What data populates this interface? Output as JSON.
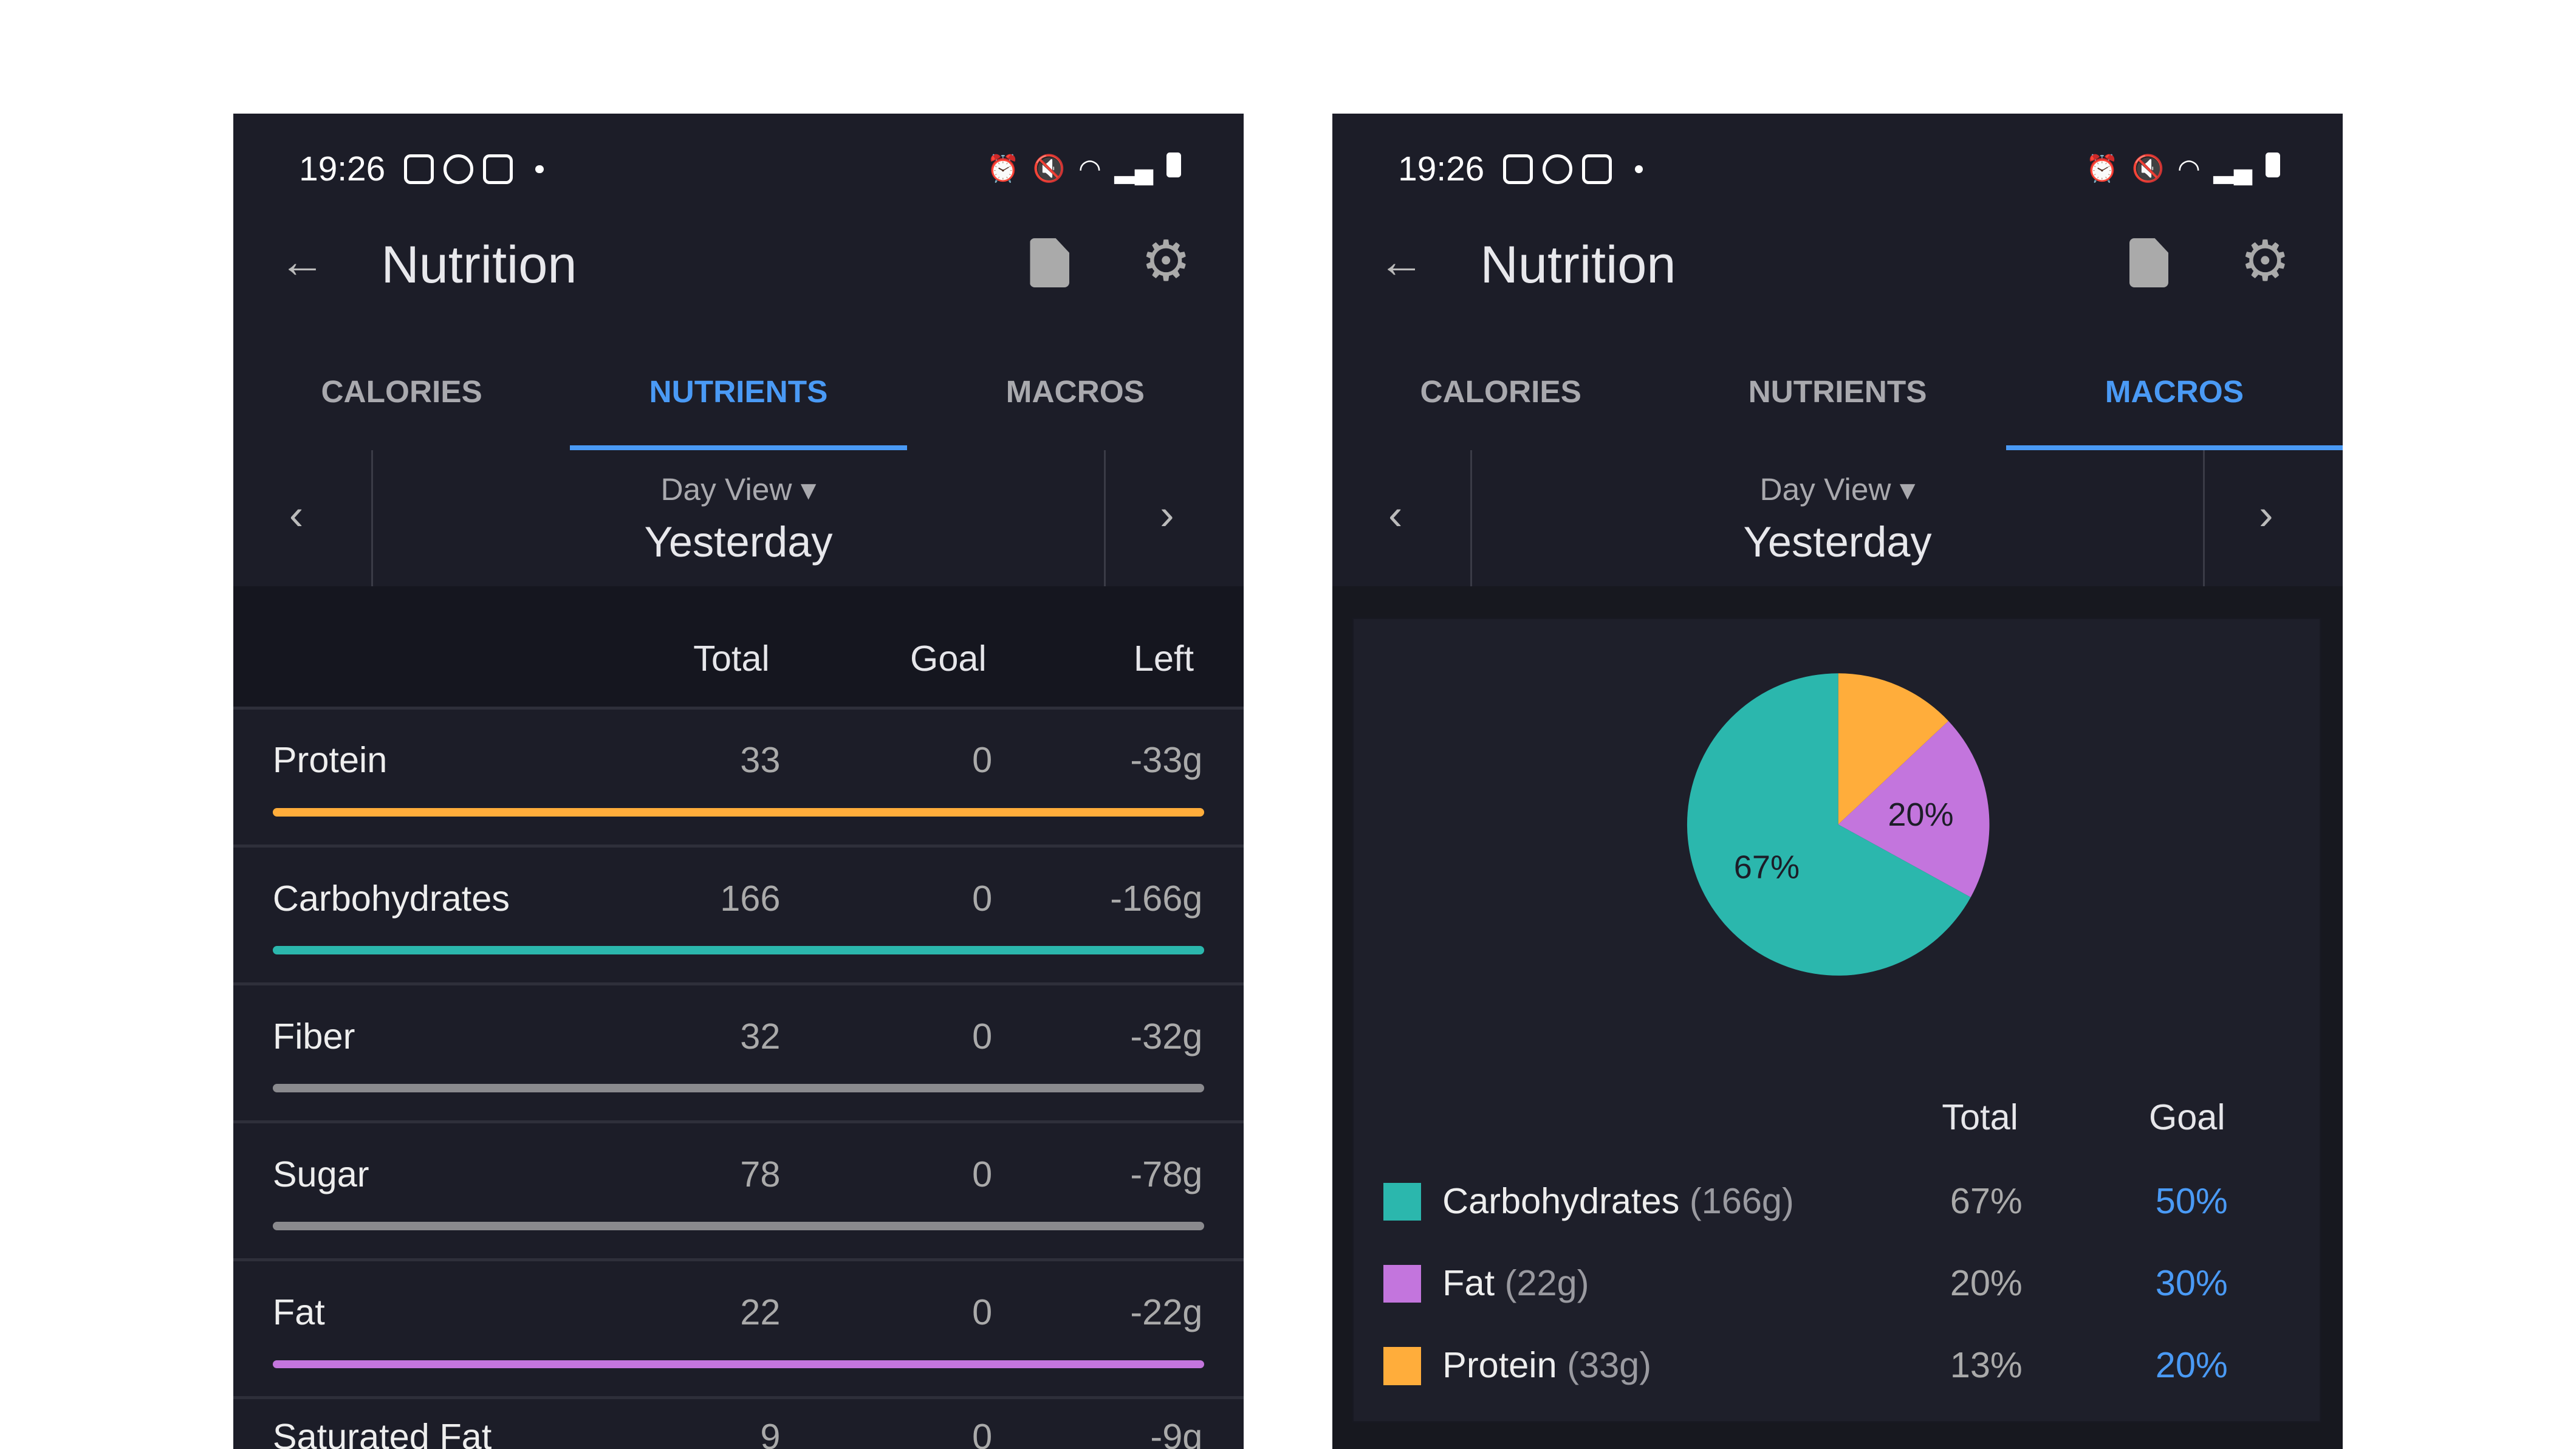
{
  "status": {
    "time": "19:26"
  },
  "header": {
    "title": "Nutrition",
    "back_icon": "arrow-left-icon",
    "export_icon": "file-export-icon",
    "settings_icon": "gear-icon"
  },
  "tabs": [
    {
      "label": "CALORIES"
    },
    {
      "label": "NUTRIENTS"
    },
    {
      "label": "MACROS"
    }
  ],
  "date_nav": {
    "view": "Day View",
    "date": "Yesterday"
  },
  "colors": {
    "accent": "#4a9af5",
    "protein": "#ffad3b",
    "carbs": "#2bb7ad",
    "fat": "#c375dd",
    "neutral": "#8a8a8e"
  },
  "nutrients": {
    "columns": [
      "Total",
      "Goal",
      "Left"
    ],
    "rows": [
      {
        "name": "Protein",
        "total": "33",
        "goal": "0",
        "left": "-33g",
        "color": "#ffad3b"
      },
      {
        "name": "Carbohydrates",
        "total": "166",
        "goal": "0",
        "left": "-166g",
        "color": "#2bb7ad"
      },
      {
        "name": "Fiber",
        "total": "32",
        "goal": "0",
        "left": "-32g",
        "color": "#8a8a8e"
      },
      {
        "name": "Sugar",
        "total": "78",
        "goal": "0",
        "left": "-78g",
        "color": "#8a8a8e"
      },
      {
        "name": "Fat",
        "total": "22",
        "goal": "0",
        "left": "-22g",
        "color": "#c375dd"
      },
      {
        "name": "Saturated Fat",
        "total": "9",
        "goal": "0",
        "left": "-9g",
        "color": "#8a8a8e"
      }
    ]
  },
  "chart_data": {
    "type": "pie",
    "slices": [
      {
        "label": "Protein",
        "value": 13,
        "color": "#ffad3b",
        "data_label": ""
      },
      {
        "label": "Fat",
        "value": 20,
        "color": "#c375dd",
        "data_label": "20%"
      },
      {
        "label": "Carbohydrates",
        "value": 67,
        "color": "#2bb7ad",
        "data_label": "67%"
      }
    ]
  },
  "macros": {
    "columns": [
      "Total",
      "Goal"
    ],
    "rows": [
      {
        "name": "Carbohydrates",
        "amount": "(166g)",
        "total": "67%",
        "goal": "50%",
        "color": "#2bb7ad"
      },
      {
        "name": "Fat",
        "amount": "(22g)",
        "total": "20%",
        "goal": "30%",
        "color": "#c375dd"
      },
      {
        "name": "Protein",
        "amount": "(33g)",
        "total": "13%",
        "goal": "20%",
        "color": "#ffad3b"
      }
    ]
  }
}
